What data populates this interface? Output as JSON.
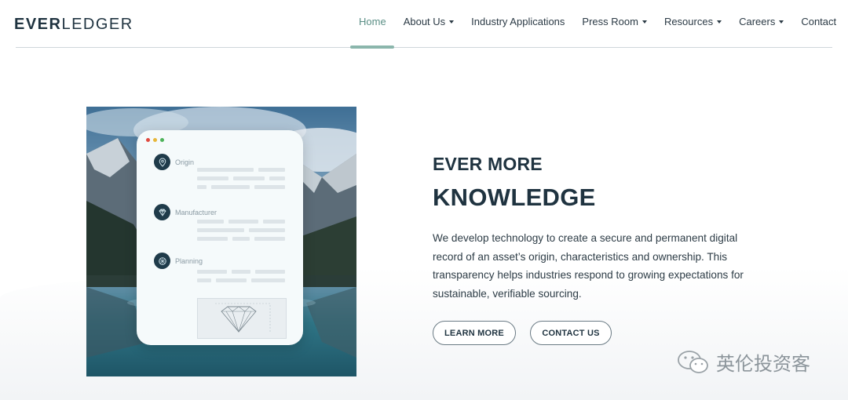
{
  "brand": {
    "logo_bold": "EVER",
    "logo_light": "LEDGER"
  },
  "nav": {
    "items": [
      {
        "label": "Home",
        "active": true,
        "dropdown": false
      },
      {
        "label": "About Us",
        "active": false,
        "dropdown": true
      },
      {
        "label": "Industry Applications",
        "active": false,
        "dropdown": false
      },
      {
        "label": "Press Room",
        "active": false,
        "dropdown": true
      },
      {
        "label": "Resources",
        "active": false,
        "dropdown": true
      },
      {
        "label": "Careers",
        "active": false,
        "dropdown": true
      },
      {
        "label": "Contact",
        "active": false,
        "dropdown": false
      }
    ]
  },
  "illustration": {
    "steps": [
      {
        "label": "Origin",
        "icon": "location-pin-icon"
      },
      {
        "label": "Manufacturer",
        "icon": "diamond-icon"
      },
      {
        "label": "Planning",
        "icon": "gem-facet-icon"
      }
    ],
    "window_dots": [
      "#e0493f",
      "#e7b73a",
      "#4db35a"
    ]
  },
  "hero": {
    "kicker": "EVER MORE",
    "headline": "KNOWLEDGE",
    "body": "We develop technology to create a secure and permanent digital record of an asset’s origin, characteristics and ownership. This transparency helps industries respond to growing expectations for sustainable, verifiable sourcing.",
    "buttons": {
      "learn_more": "LEARN MORE",
      "contact_us": "CONTACT US"
    }
  },
  "watermark": {
    "text": "英伦投资客"
  },
  "colors": {
    "accent": "#8bb6ac",
    "text_dark": "#1f3340",
    "card_bg": "#f5fafb"
  }
}
